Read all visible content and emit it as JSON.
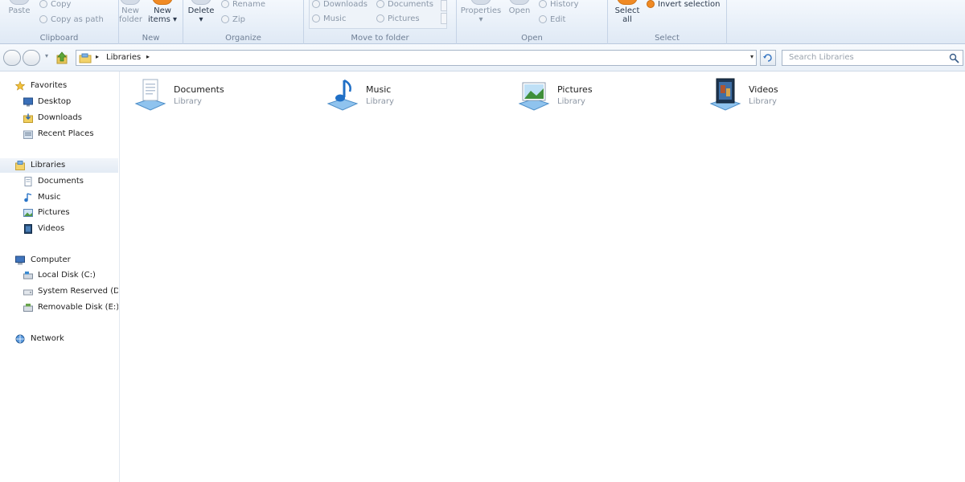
{
  "ribbon": {
    "groups": {
      "clipboard": "Clipboard",
      "new": "New",
      "organize": "Organize",
      "move_to_folder": "Move to folder",
      "open": "Open",
      "select": "Select"
    },
    "paste": "Paste",
    "copy": "Copy",
    "copy_as_path": "Copy as path",
    "new_folder": [
      "New",
      "folder"
    ],
    "new_items": [
      "New",
      "items ▾"
    ],
    "delete": "Delete",
    "rename": "Rename",
    "zip": "Zip",
    "move_downloads": "Downloads",
    "move_music": "Music",
    "move_documents": "Documents",
    "move_pictures": "Pictures",
    "properties": "Properties",
    "open_btn": "Open",
    "history": "History",
    "edit": "Edit",
    "select_all": [
      "Select",
      "all"
    ],
    "invert_selection": "Invert selection"
  },
  "address": {
    "path": "Libraries",
    "search_placeholder": "Search Libraries"
  },
  "nav": {
    "favorites": "Favorites",
    "desktop": "Desktop",
    "downloads": "Downloads",
    "recent": "Recent Places",
    "libraries": "Libraries",
    "documents": "Documents",
    "music": "Music",
    "pictures": "Pictures",
    "videos": "Videos",
    "computer": "Computer",
    "local_disk": "Local Disk (C:)",
    "system_reserved": "System Reserved (D:",
    "removable": "Removable Disk (E:)",
    "network": "Network"
  },
  "libraries": [
    {
      "name": "Documents",
      "sub": "Library",
      "icon": "documents-library-icon"
    },
    {
      "name": "Music",
      "sub": "Library",
      "icon": "music-library-icon"
    },
    {
      "name": "Pictures",
      "sub": "Library",
      "icon": "pictures-library-icon"
    },
    {
      "name": "Videos",
      "sub": "Library",
      "icon": "videos-library-icon"
    }
  ]
}
